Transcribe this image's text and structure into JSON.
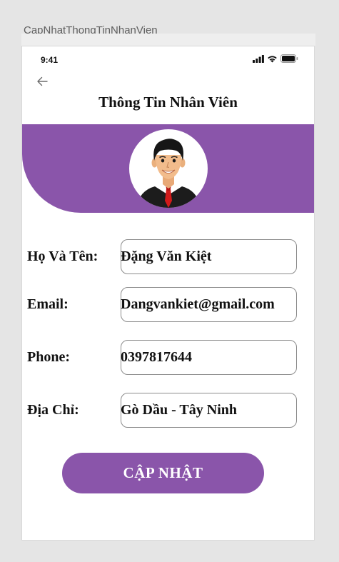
{
  "frame": {
    "title": "CapNhatThongTinNhanVien"
  },
  "status_bar": {
    "time": "9:41",
    "icons": [
      "signal-icon",
      "wifi-icon",
      "battery-icon"
    ]
  },
  "header": {
    "back_icon": "arrow-left-icon",
    "title": "Thông Tin Nhân Viên"
  },
  "profile": {
    "avatar_icon": "businessman-avatar"
  },
  "form": {
    "fields": [
      {
        "label": "Họ Và Tên:",
        "value": "Đặng Văn Kiệt"
      },
      {
        "label": "Email:",
        "value": "Dangvankiet@gmail.com"
      },
      {
        "label": "Phone:",
        "value": "0397817644"
      },
      {
        "label": "Địa Chỉ:",
        "value": "Gò Dầu - Tây Ninh"
      }
    ]
  },
  "actions": {
    "update_label": "CẬP NHẬT"
  },
  "colors": {
    "accent": "#8a55aa",
    "background": "#ffffff",
    "frame": "#e5e5e5"
  }
}
